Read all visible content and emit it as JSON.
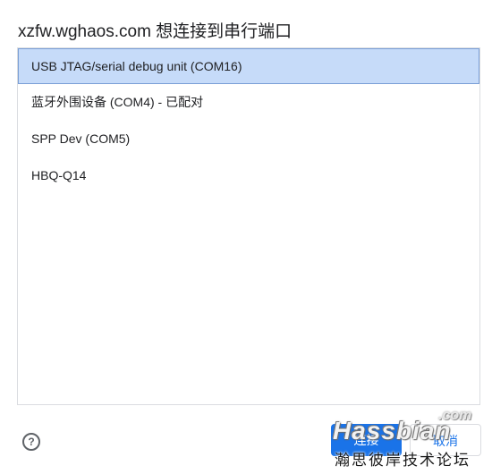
{
  "dialog": {
    "title": "xzfw.wghaos.com 想连接到串行端口"
  },
  "ports": [
    {
      "label": "USB JTAG/serial debug unit (COM16)",
      "selected": true
    },
    {
      "label": "蓝牙外围设备 (COM4) - 已配对",
      "selected": false
    },
    {
      "label": "SPP Dev (COM5)",
      "selected": false
    },
    {
      "label": "HBQ-Q14",
      "selected": false
    }
  ],
  "footer": {
    "help_icon": "?",
    "connect_label": "连接",
    "cancel_label": "取消"
  },
  "watermark": {
    "domain_suffix": ".com",
    "brand": "Hassbian",
    "subtitle": "瀚思彼岸技术论坛"
  },
  "colors": {
    "accent": "#1a73e8",
    "selected_bg": "#c6dbf9",
    "selected_border": "#7a9fd6",
    "border": "#dadce0"
  }
}
